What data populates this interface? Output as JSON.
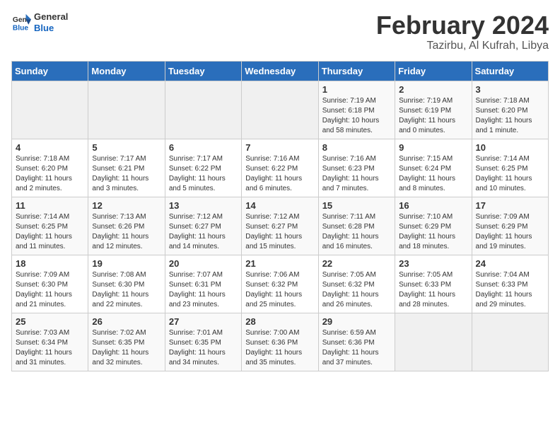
{
  "logo": {
    "line1": "General",
    "line2": "Blue"
  },
  "title": "February 2024",
  "subtitle": "Tazirbu, Al Kufrah, Libya",
  "headers": [
    "Sunday",
    "Monday",
    "Tuesday",
    "Wednesday",
    "Thursday",
    "Friday",
    "Saturday"
  ],
  "weeks": [
    [
      {
        "day": "",
        "info": ""
      },
      {
        "day": "",
        "info": ""
      },
      {
        "day": "",
        "info": ""
      },
      {
        "day": "",
        "info": ""
      },
      {
        "day": "1",
        "info": "Sunrise: 7:19 AM\nSunset: 6:18 PM\nDaylight: 10 hours and 58 minutes."
      },
      {
        "day": "2",
        "info": "Sunrise: 7:19 AM\nSunset: 6:19 PM\nDaylight: 11 hours and 0 minutes."
      },
      {
        "day": "3",
        "info": "Sunrise: 7:18 AM\nSunset: 6:20 PM\nDaylight: 11 hours and 1 minute."
      }
    ],
    [
      {
        "day": "4",
        "info": "Sunrise: 7:18 AM\nSunset: 6:20 PM\nDaylight: 11 hours and 2 minutes."
      },
      {
        "day": "5",
        "info": "Sunrise: 7:17 AM\nSunset: 6:21 PM\nDaylight: 11 hours and 3 minutes."
      },
      {
        "day": "6",
        "info": "Sunrise: 7:17 AM\nSunset: 6:22 PM\nDaylight: 11 hours and 5 minutes."
      },
      {
        "day": "7",
        "info": "Sunrise: 7:16 AM\nSunset: 6:22 PM\nDaylight: 11 hours and 6 minutes."
      },
      {
        "day": "8",
        "info": "Sunrise: 7:16 AM\nSunset: 6:23 PM\nDaylight: 11 hours and 7 minutes."
      },
      {
        "day": "9",
        "info": "Sunrise: 7:15 AM\nSunset: 6:24 PM\nDaylight: 11 hours and 8 minutes."
      },
      {
        "day": "10",
        "info": "Sunrise: 7:14 AM\nSunset: 6:25 PM\nDaylight: 11 hours and 10 minutes."
      }
    ],
    [
      {
        "day": "11",
        "info": "Sunrise: 7:14 AM\nSunset: 6:25 PM\nDaylight: 11 hours and 11 minutes."
      },
      {
        "day": "12",
        "info": "Sunrise: 7:13 AM\nSunset: 6:26 PM\nDaylight: 11 hours and 12 minutes."
      },
      {
        "day": "13",
        "info": "Sunrise: 7:12 AM\nSunset: 6:27 PM\nDaylight: 11 hours and 14 minutes."
      },
      {
        "day": "14",
        "info": "Sunrise: 7:12 AM\nSunset: 6:27 PM\nDaylight: 11 hours and 15 minutes."
      },
      {
        "day": "15",
        "info": "Sunrise: 7:11 AM\nSunset: 6:28 PM\nDaylight: 11 hours and 16 minutes."
      },
      {
        "day": "16",
        "info": "Sunrise: 7:10 AM\nSunset: 6:29 PM\nDaylight: 11 hours and 18 minutes."
      },
      {
        "day": "17",
        "info": "Sunrise: 7:09 AM\nSunset: 6:29 PM\nDaylight: 11 hours and 19 minutes."
      }
    ],
    [
      {
        "day": "18",
        "info": "Sunrise: 7:09 AM\nSunset: 6:30 PM\nDaylight: 11 hours and 21 minutes."
      },
      {
        "day": "19",
        "info": "Sunrise: 7:08 AM\nSunset: 6:30 PM\nDaylight: 11 hours and 22 minutes."
      },
      {
        "day": "20",
        "info": "Sunrise: 7:07 AM\nSunset: 6:31 PM\nDaylight: 11 hours and 23 minutes."
      },
      {
        "day": "21",
        "info": "Sunrise: 7:06 AM\nSunset: 6:32 PM\nDaylight: 11 hours and 25 minutes."
      },
      {
        "day": "22",
        "info": "Sunrise: 7:05 AM\nSunset: 6:32 PM\nDaylight: 11 hours and 26 minutes."
      },
      {
        "day": "23",
        "info": "Sunrise: 7:05 AM\nSunset: 6:33 PM\nDaylight: 11 hours and 28 minutes."
      },
      {
        "day": "24",
        "info": "Sunrise: 7:04 AM\nSunset: 6:33 PM\nDaylight: 11 hours and 29 minutes."
      }
    ],
    [
      {
        "day": "25",
        "info": "Sunrise: 7:03 AM\nSunset: 6:34 PM\nDaylight: 11 hours and 31 minutes."
      },
      {
        "day": "26",
        "info": "Sunrise: 7:02 AM\nSunset: 6:35 PM\nDaylight: 11 hours and 32 minutes."
      },
      {
        "day": "27",
        "info": "Sunrise: 7:01 AM\nSunset: 6:35 PM\nDaylight: 11 hours and 34 minutes."
      },
      {
        "day": "28",
        "info": "Sunrise: 7:00 AM\nSunset: 6:36 PM\nDaylight: 11 hours and 35 minutes."
      },
      {
        "day": "29",
        "info": "Sunrise: 6:59 AM\nSunset: 6:36 PM\nDaylight: 11 hours and 37 minutes."
      },
      {
        "day": "",
        "info": ""
      },
      {
        "day": "",
        "info": ""
      }
    ]
  ]
}
